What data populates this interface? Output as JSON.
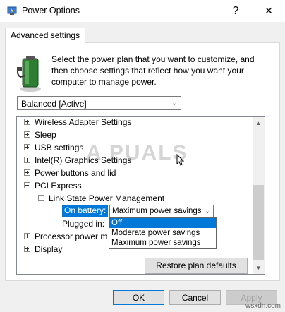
{
  "window": {
    "title": "Power Options",
    "help_glyph": "?",
    "close_glyph": "✕"
  },
  "tab": {
    "label": "Advanced settings"
  },
  "description": "Select the power plan that you want to customize, and then choose settings that reflect how you want your computer to manage power.",
  "plan_select": {
    "value": "Balanced [Active]"
  },
  "tree": {
    "items": [
      {
        "label": "Wireless Adapter Settings",
        "state": "collapsed"
      },
      {
        "label": "Sleep",
        "state": "collapsed"
      },
      {
        "label": "USB settings",
        "state": "collapsed"
      },
      {
        "label": "Intel(R) Graphics Settings",
        "state": "collapsed"
      },
      {
        "label": "Power buttons and lid",
        "state": "collapsed"
      },
      {
        "label": "PCI Express",
        "state": "expanded"
      },
      {
        "label": "Link State Power Management",
        "state": "expanded"
      },
      {
        "label": "On battery:",
        "state": "selected"
      },
      {
        "label": "Plugged in:",
        "state": "leaf"
      },
      {
        "label": "Processor power m",
        "state": "collapsed"
      },
      {
        "label": "Display",
        "state": "collapsed"
      }
    ]
  },
  "on_battery_combo": {
    "value": "Maximum power savings",
    "options": [
      "Off",
      "Moderate power savings",
      "Maximum power savings"
    ],
    "highlighted": "Off"
  },
  "buttons": {
    "restore": "Restore plan defaults",
    "ok": "OK",
    "cancel": "Cancel",
    "apply": "Apply"
  },
  "watermark": {
    "text": "A PUALS",
    "site": "wsxdn.com"
  },
  "colors": {
    "selection": "#0078d7",
    "panel_bg": "#f0f0f0"
  }
}
